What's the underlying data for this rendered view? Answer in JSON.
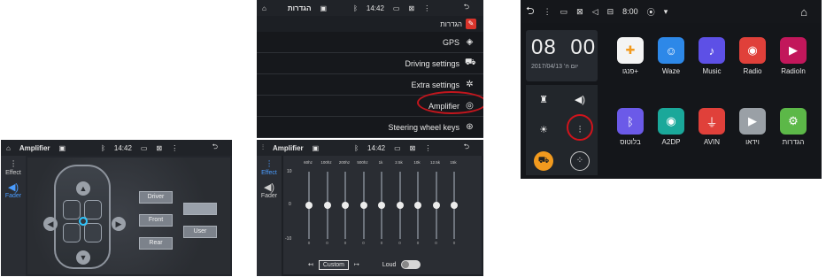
{
  "colors": {
    "accent_blue": "#4a9cff",
    "highlight_red": "#c2161d",
    "panel_dark": "#1a1d22"
  },
  "fader_screen": {
    "status": {
      "home_icon": "home-icon",
      "title": "Amplifier",
      "time": "14:42",
      "bluetooth_icon": "bluetooth-icon",
      "back_icon": "back-icon"
    },
    "tabs": [
      {
        "label": "Effect",
        "icon": "equalizer-icon"
      },
      {
        "label": "Fader",
        "icon": "speaker-icon"
      }
    ],
    "buttons": {
      "driver": "Driver",
      "front": "Front",
      "rear": "Rear",
      "user": "User"
    }
  },
  "settings_screen": {
    "status": {
      "home_icon": "home-icon",
      "title": "הגדרות",
      "time": "14:42",
      "back_icon": "back-icon"
    },
    "header": "הגדרות",
    "items": [
      {
        "label": "GPS",
        "icon": "gps-icon"
      },
      {
        "label": "Driving settings",
        "icon": "car-icon"
      },
      {
        "label": "Extra settings",
        "icon": "extra-settings-icon"
      },
      {
        "label": "Amplifier",
        "icon": "amplifier-icon"
      },
      {
        "label": "Steering wheel keys",
        "icon": "steering-wheel-icon"
      }
    ]
  },
  "eq_screen": {
    "status": {
      "title": "Amplifier",
      "time": "14:42"
    },
    "tabs": [
      {
        "label": "Effect",
        "icon": "equalizer-icon"
      },
      {
        "label": "Fader",
        "icon": "speaker-icon"
      }
    ],
    "scale_top": "10",
    "scale_mid": "0",
    "scale_bottom": "-10",
    "bands": [
      {
        "freq": "60hz",
        "value": 0
      },
      {
        "freq": "100hz",
        "value": 0
      },
      {
        "freq": "200hz",
        "value": 0
      },
      {
        "freq": "500hz",
        "value": 0
      },
      {
        "freq": "1k",
        "value": 0
      },
      {
        "freq": "2.5k",
        "value": 0
      },
      {
        "freq": "10k",
        "value": 0
      },
      {
        "freq": "12.5k",
        "value": 0
      },
      {
        "freq": "15k",
        "value": 0
      }
    ],
    "preset": "Custom",
    "loud_label": "Loud",
    "loud_on": false
  },
  "home_screen": {
    "status": {
      "time": "8:00",
      "home_icon": "home-icon"
    },
    "clock": {
      "hours": "08",
      "minutes": "00",
      "date": "2017/04/13 'יום ה"
    },
    "apps_row1": [
      {
        "label": "פנגו+",
        "icon": "pango-icon",
        "color": "#f4f4f4"
      },
      {
        "label": "Waze",
        "icon": "waze-icon",
        "color": "#2d88e8"
      },
      {
        "label": "Music",
        "icon": "music-icon",
        "color": "#5d50e6"
      },
      {
        "label": "Radio",
        "icon": "radio-icon",
        "color": "#e0403a"
      },
      {
        "label": "RadioIn",
        "icon": "radioin-icon",
        "color": "#c2175b"
      }
    ],
    "apps_row2": [
      {
        "label": "בלוטוס",
        "icon": "bluetooth-icon",
        "color": "#6b5ae8"
      },
      {
        "label": "A2DP",
        "icon": "a2dp-icon",
        "color": "#1aa89a"
      },
      {
        "label": "AVIN",
        "icon": "avin-icon",
        "color": "#e0403a"
      },
      {
        "label": "וידאו",
        "icon": "video-icon",
        "color": "#9aa0a6"
      },
      {
        "label": "הגדרות",
        "icon": "settings-icon",
        "color": "#5cb848"
      }
    ]
  }
}
